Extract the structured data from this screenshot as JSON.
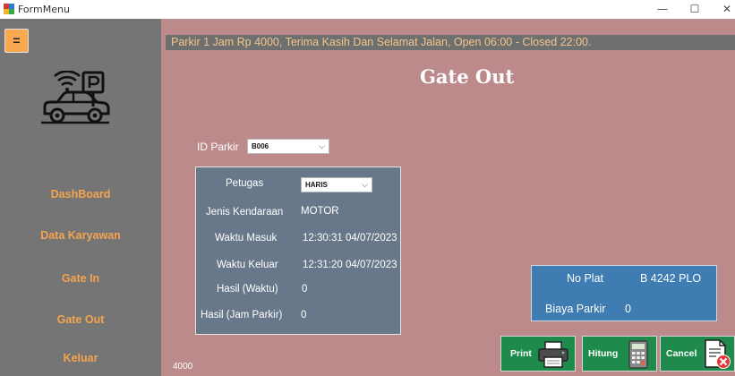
{
  "window": {
    "title": "FormMenu",
    "minimize_glyph": "—",
    "maximize_glyph": "☐",
    "close_glyph": "✕"
  },
  "sidebar": {
    "menu_toggle_glyph": "=",
    "logo_icon": "car-parking-wifi-icon",
    "items": [
      {
        "label": "DashBoard"
      },
      {
        "label": "Data Karyawan"
      },
      {
        "label": "Gate In"
      },
      {
        "label": "Gate Out"
      },
      {
        "label": "Keluar"
      }
    ]
  },
  "header": {
    "marquee": "Parkir 1 Jam Rp 4000, Terima Kasih Dan Selamat Jalan, Open 06:00 - Closed 22:00.",
    "page_title": "Gate Out"
  },
  "form": {
    "id_parkir_label": "ID Parkir",
    "id_parkir_value": "B006",
    "petugas_label": "Petugas",
    "petugas_value": "HARIS",
    "jenis_kendaraan_label": "Jenis Kendaraan",
    "jenis_kendaraan_value": "MOTOR",
    "waktu_masuk_label": "Waktu Masuk",
    "waktu_masuk_value": "12:30:31 04/07/2023",
    "waktu_keluar_label": "Waktu Keluar",
    "waktu_keluar_value": "12:31:20 04/07/2023",
    "hasil_waktu_label": "Hasil (Waktu)",
    "hasil_waktu_value": "0",
    "hasil_jam_label": "Hasil (Jam Parkir)",
    "hasil_jam_value": "0"
  },
  "summary": {
    "no_plat_label": "No Plat",
    "no_plat_value": "B 4242 PLO",
    "biaya_label": "Biaya Parkir",
    "biaya_value": "0"
  },
  "actions": {
    "print_label": "Print",
    "print_icon": "printer-icon",
    "hitung_label": "Hitung",
    "hitung_icon": "calculator-icon",
    "cancel_label": "Cancel",
    "cancel_icon": "cancel-document-icon"
  },
  "footer": {
    "value": "4000"
  },
  "colors": {
    "sidebar_bg": "#757575",
    "menu_accent": "#f4a44f",
    "main_bg": "#bc8a8a",
    "details_bg": "#68788a",
    "plate_bg": "#3e7cb1",
    "button_bg": "#1e8a4c"
  }
}
